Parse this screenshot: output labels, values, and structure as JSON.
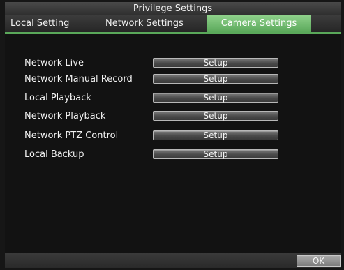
{
  "window": {
    "title": "Privilege Settings"
  },
  "tabs": [
    {
      "label": "Local Setting"
    },
    {
      "label": "Network Settings"
    },
    {
      "label": "Camera Settings",
      "active": true
    }
  ],
  "rows": [
    {
      "label": "Network Live",
      "button": "Setup"
    },
    {
      "label": "Network Manual Record",
      "button": "Setup"
    },
    {
      "label": "Local Playback",
      "button": "Setup"
    },
    {
      "label": "Network Playback",
      "button": "Setup"
    },
    {
      "label": "Network PTZ Control",
      "button": "Setup"
    },
    {
      "label": "Local Backup",
      "button": "Setup"
    }
  ],
  "footer": {
    "ok_label": "OK"
  },
  "colors": {
    "active_tab": "#6fbf6c",
    "background": "#121212",
    "button_border": "#b8b8b8"
  }
}
